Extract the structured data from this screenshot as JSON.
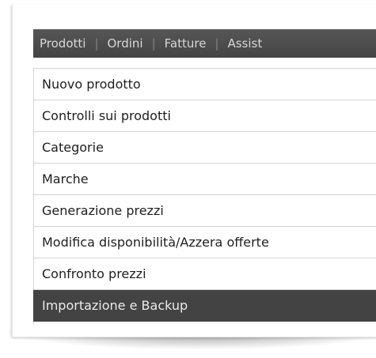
{
  "menu": {
    "tabs": [
      {
        "label": "Prodotti"
      },
      {
        "label": "Ordini"
      },
      {
        "label": "Fatture"
      },
      {
        "label": "Assist"
      }
    ],
    "separator": "|"
  },
  "dropdown": {
    "items": [
      {
        "label": "Nuovo prodotto"
      },
      {
        "label": "Controlli sui prodotti"
      },
      {
        "label": "Categorie"
      },
      {
        "label": "Marche"
      },
      {
        "label": "Generazione prezzi"
      },
      {
        "label": "Modifica disponibilità/Azzera offerte"
      },
      {
        "label": "Confronto prezzi"
      },
      {
        "label": "Importazione e Backup"
      }
    ],
    "active_index": 7
  },
  "colors": {
    "menu_bar": "#4a4a4a",
    "menu_text": "#d8d8d8",
    "active_item_bg": "#434343",
    "active_item_text": "#ebebeb",
    "item_text": "#1e1e1e",
    "divider": "#d4d4d4"
  }
}
